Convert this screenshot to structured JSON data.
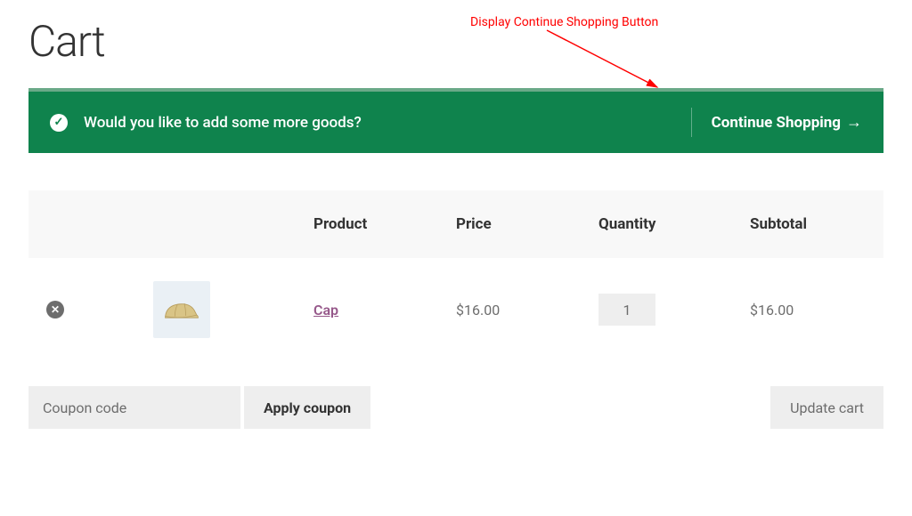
{
  "page": {
    "title": "Cart"
  },
  "annotation": {
    "label": "Display Continue Shopping Button"
  },
  "banner": {
    "message": "Would you like to add some more goods?",
    "continue_label": "Continue Shopping"
  },
  "table": {
    "headers": {
      "product": "Product",
      "price": "Price",
      "quantity": "Quantity",
      "subtotal": "Subtotal"
    },
    "items": [
      {
        "name": "Cap",
        "price": "$16.00",
        "quantity": "1",
        "subtotal": "$16.00"
      }
    ]
  },
  "actions": {
    "coupon_placeholder": "Coupon code",
    "apply_label": "Apply coupon",
    "update_label": "Update cart"
  }
}
